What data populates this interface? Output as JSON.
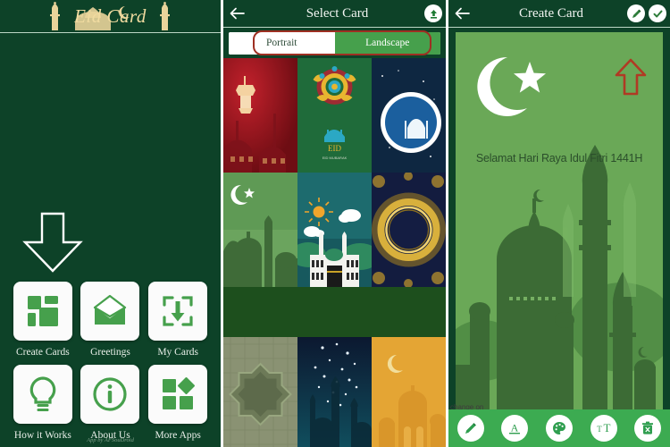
{
  "app": {
    "name": "Eid Card",
    "credit": "App by AFSouDroid",
    "accent_green": "#46a04c",
    "dark_green": "#0d4228",
    "gold": "#f0dba0",
    "annotation_red": "#9e2f22"
  },
  "home": {
    "logo_text": "Eid Card",
    "tiles": [
      {
        "label": "Create Cards",
        "icon": "grid-icon"
      },
      {
        "label": "Greetings",
        "icon": "envelope-icon"
      },
      {
        "label": "My Cards",
        "icon": "download-box-icon"
      },
      {
        "label": "How it Works",
        "icon": "lightbulb-icon"
      },
      {
        "label": "About Us",
        "icon": "info-circle-icon"
      },
      {
        "label": "More Apps",
        "icon": "shapes-icon"
      }
    ],
    "arrow_annotation": "down-arrow-annotation"
  },
  "select": {
    "title": "Select Card",
    "back_icon": "back-arrow-icon",
    "upload_icon": "upload-icon",
    "orientation": {
      "selected": "Landscape",
      "options": [
        "Portrait",
        "Landscape"
      ]
    },
    "cards": [
      {
        "name": "red-lantern-card"
      },
      {
        "name": "mandala-eid-mubarak-card"
      },
      {
        "name": "blue-crescent-mosque-card"
      },
      {
        "name": "green-crescent-mosque-card"
      },
      {
        "name": "kaaba-daylight-card"
      },
      {
        "name": "gold-ornament-circle-card"
      },
      {
        "name": "olive-star-pattern-card"
      },
      {
        "name": "night-city-lights-card"
      },
      {
        "name": "amber-mosque-moon-card"
      }
    ],
    "ad_banner": ""
  },
  "create": {
    "title": "Create Card",
    "back_icon": "back-arrow-icon",
    "edit_icon": "pencil-icon",
    "done_icon": "check-icon",
    "card_text": "Selamat Hari Raya Idul Fitri 1441H",
    "arrow_annotation": "up-arrow-annotation",
    "partial_hint": "change on",
    "toolbar": [
      {
        "name": "draw-tool",
        "icon": "pencil-icon",
        "glyph": "✎"
      },
      {
        "name": "font-tool",
        "icon": "font-a-icon",
        "glyph": "A"
      },
      {
        "name": "color-tool",
        "icon": "palette-icon",
        "glyph": "●"
      },
      {
        "name": "text-size-tool",
        "icon": "text-size-icon",
        "glyph": "тT"
      },
      {
        "name": "delete-tool",
        "icon": "trash-icon",
        "glyph": "Ὕ1"
      }
    ]
  }
}
